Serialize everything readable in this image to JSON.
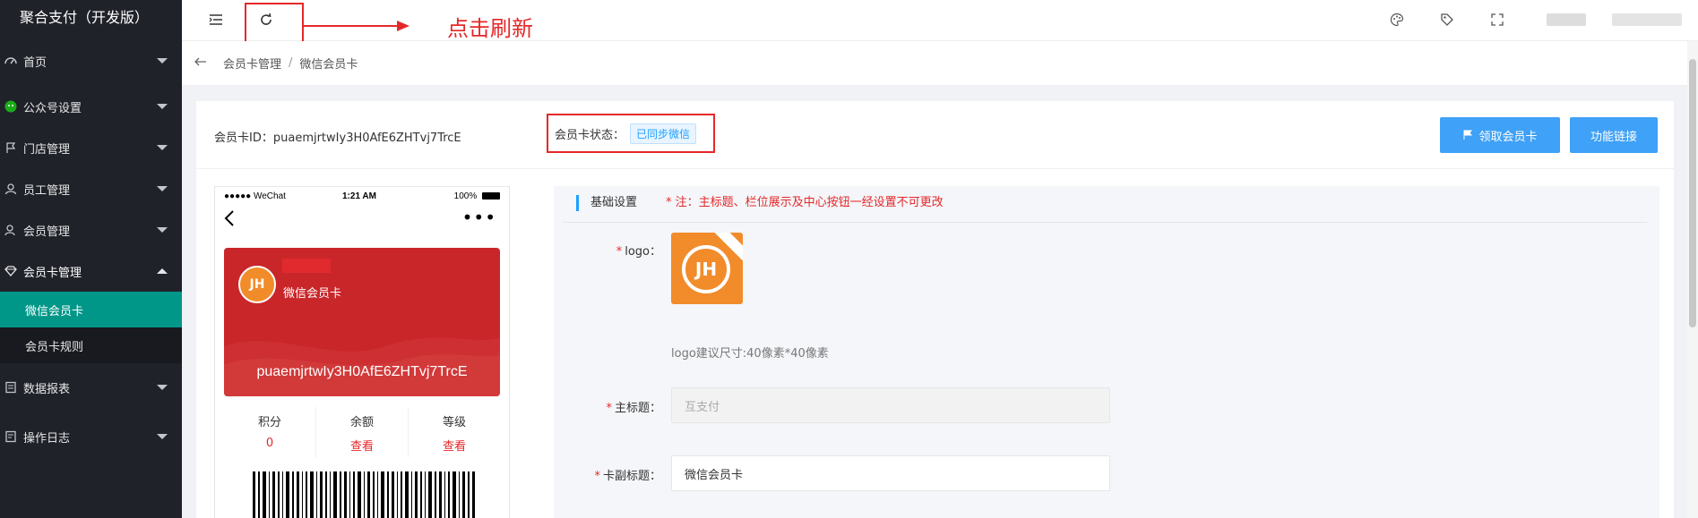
{
  "app": {
    "title": "聚合支付（开发版）"
  },
  "sidebar": {
    "items": [
      {
        "label": "首页",
        "icon": "dashboard-icon"
      },
      {
        "label": "公众号设置",
        "icon": "wechat-icon"
      },
      {
        "label": "门店管理",
        "icon": "flag-icon"
      },
      {
        "label": "员工管理",
        "icon": "user-icon"
      },
      {
        "label": "会员管理",
        "icon": "users-icon"
      },
      {
        "label": "会员卡管理",
        "icon": "diamond-icon",
        "expanded": true
      }
    ],
    "sub_items": [
      {
        "label": "微信会员卡",
        "active": true
      },
      {
        "label": "会员卡规则",
        "active": false
      }
    ],
    "items_after": [
      {
        "label": "数据报表",
        "icon": "report-icon"
      },
      {
        "label": "操作日志",
        "icon": "log-icon"
      }
    ]
  },
  "header": {
    "annotation": "点击刷新"
  },
  "breadcrumb": {
    "items": [
      "会员卡管理",
      "微信会员卡"
    ]
  },
  "card": {
    "id_label": "会员卡ID：",
    "id_value": "puaemjrtwIy3H0AfE6ZHTvj7TrcE",
    "status_label": "会员卡状态：",
    "status_value": "已同步微信",
    "btn_receive": "领取会员卡",
    "btn_link": "功能链接"
  },
  "phone": {
    "carrier": "●●●●● WeChat",
    "time": "1:21 AM",
    "battery": "100%",
    "card_subtitle": "微信会员卡",
    "card_code": "puaemjrtwIy3H0AfE6ZHTvj7TrcE",
    "stats": [
      {
        "label": "积分",
        "value": "0"
      },
      {
        "label": "余额",
        "value": "查看"
      },
      {
        "label": "等级",
        "value": "查看"
      }
    ]
  },
  "settings": {
    "section_title": "基础设置",
    "note": "* 注：主标题、栏位展示及中心按钮一经设置不可更改",
    "logo_label": "logo：",
    "logo_hint": "logo建议尺寸:40像素*40像素",
    "main_title_label": "主标题：",
    "main_title_value": "互支付",
    "sub_title_label": "卡副标题：",
    "sub_title_value": "微信会员卡"
  },
  "colors": {
    "sidebar_bg": "#20222a",
    "active_green": "#009688",
    "primary_blue": "#3fa1f7",
    "annotation_red": "#e5282a",
    "card_red": "#c9262a",
    "logo_orange": "#f28b2a"
  }
}
